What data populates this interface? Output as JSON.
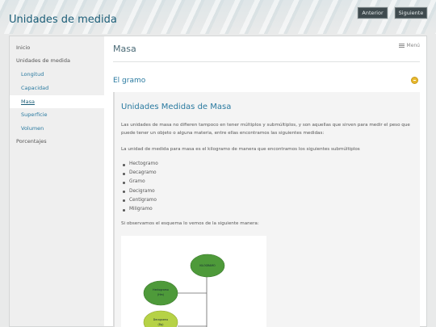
{
  "site": {
    "title": "Unidades de medida"
  },
  "toolbar": {
    "prev_label": "Anterior",
    "next_label": "Siguiente"
  },
  "sidebar": {
    "items": [
      {
        "label": "Inicio"
      },
      {
        "label": "Unidades de medida"
      },
      {
        "label": "Longitud"
      },
      {
        "label": "Capacidad"
      },
      {
        "label": "Masa"
      },
      {
        "label": "Superficie"
      },
      {
        "label": "Volumen"
      },
      {
        "label": "Porcentajes"
      }
    ],
    "active": "Masa"
  },
  "main": {
    "title": "Masa",
    "menu_label": "Menú",
    "section_title": "El gramo",
    "panel": {
      "heading": "Unidades Medidas de Masa",
      "para1": "Las unidades de masa no difieren tampoco en tener múltiplos y submúltiplos, y son aquellas que sirven para medir el peso que puede tener un objeto o alguna materia, entre ellas encontramos las siguientes medidas:",
      "para2": "La unidad de medida para masa es el kilogramo de manera que encontramos los siguientes submúltiplos",
      "list": [
        "Hectogramo",
        "Decagramo",
        "Gramo",
        "Decigramo",
        "Centigramo",
        "Miligramo"
      ],
      "para3": "Si observamos el esquema lo vemos de la siguiente manera:"
    },
    "diagram": {
      "nodes": [
        {
          "label": "KILOGRAMO",
          "sub": ""
        },
        {
          "label": "Hectogramo",
          "sub": "(Hm)"
        },
        {
          "label": "Decagramo",
          "sub": "(Dg)"
        }
      ]
    }
  },
  "colors": {
    "accent": "#2a7aa0",
    "title": "#1c5e78",
    "node_dark": "#4e9a3a",
    "node_light": "#b6d246",
    "toggle": "#e8b92f"
  }
}
